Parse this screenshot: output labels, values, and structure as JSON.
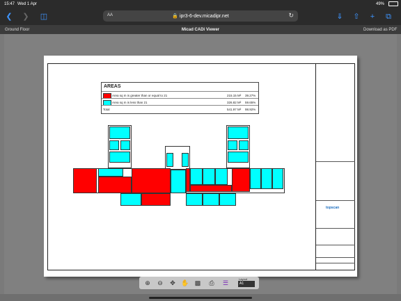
{
  "status": {
    "time": "15:47",
    "date": "Wed 1 Apr",
    "battery": "49%"
  },
  "browser": {
    "url": "ipr3-6-dev.micadipr.net",
    "text_size_label": "AA"
  },
  "app": {
    "left_title": "Ground Floor",
    "center_title": "Micad CADi Viewer",
    "right_action": "Download as PDF"
  },
  "areas": {
    "title": "AREAS",
    "rows": [
      {
        "label": "Area sq m is greater than or equal to 21",
        "value": "215.15 M²",
        "percent": "39.27%",
        "color": "#ff0000"
      },
      {
        "label": "Area sq m is less than 21",
        "value": "326.82 M²",
        "percent": "59.65%",
        "color": "#00ffff"
      },
      {
        "label": "Total",
        "value": "541.97 M²",
        "percent": "98.92%"
      }
    ]
  },
  "titleblock": {
    "logo": "topscan"
  },
  "zoom": {
    "layout_label": "Layout",
    "layout_value": "A1"
  },
  "icons": [
    "back-icon",
    "forward-icon",
    "sidebar-icon",
    "lock-icon",
    "reload-icon",
    "download-icon",
    "share-icon",
    "new-tab-icon",
    "tabs-icon",
    "zoom-in-icon",
    "zoom-out-icon",
    "pan-icon",
    "hand-icon",
    "select-icon",
    "print-icon",
    "layers-icon"
  ]
}
